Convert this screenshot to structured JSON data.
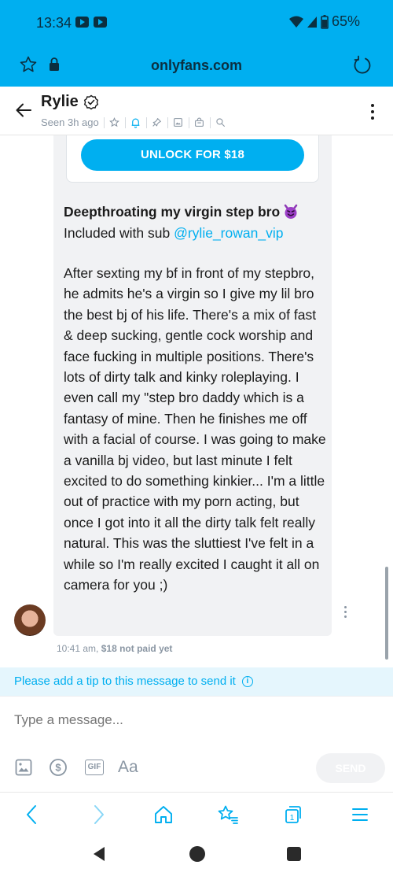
{
  "status_bar": {
    "time": "13:34",
    "battery": "65%"
  },
  "browser": {
    "url": "onlyfans.com"
  },
  "chat_header": {
    "name": "Rylie",
    "seen": "Seen 3h ago"
  },
  "message": {
    "unlock_label": "UNLOCK FOR $18",
    "title": "Deepthroating my virgin step bro",
    "included_prefix": "Included with sub ",
    "mention": "@rylie_rowan_vip",
    "body": "After sexting my bf in front of my stepbro, he admits he's a virgin so I give my lil bro the best bj of his life. There's a mix of fast & deep sucking, gentle cock worship and face fucking in multiple positions. There's lots of dirty talk and kinky roleplaying. I even call my \"step bro daddy which is a fantasy of mine. Then he finishes me off with a facial of course. I was going to make a vanilla bj video, but last minute I felt excited to do something kinkier... I'm a little out of practice with my porn acting, but once I got into it all the dirty talk felt really natural. This was the sluttiest I've felt in a while so I'm really excited I caught it all on camera for you ;)",
    "time": "10:41 am,",
    "price_status": "$18 not paid yet"
  },
  "tip_banner": {
    "text": "Please add a tip to this message to send it"
  },
  "composer": {
    "placeholder": "Type a message...",
    "gif_label": "GIF",
    "text_label": "Aa",
    "send_label": "SEND"
  },
  "colors": {
    "accent": "#00aff0",
    "muted": "#8a96a3",
    "bubble": "#f1f2f4"
  }
}
